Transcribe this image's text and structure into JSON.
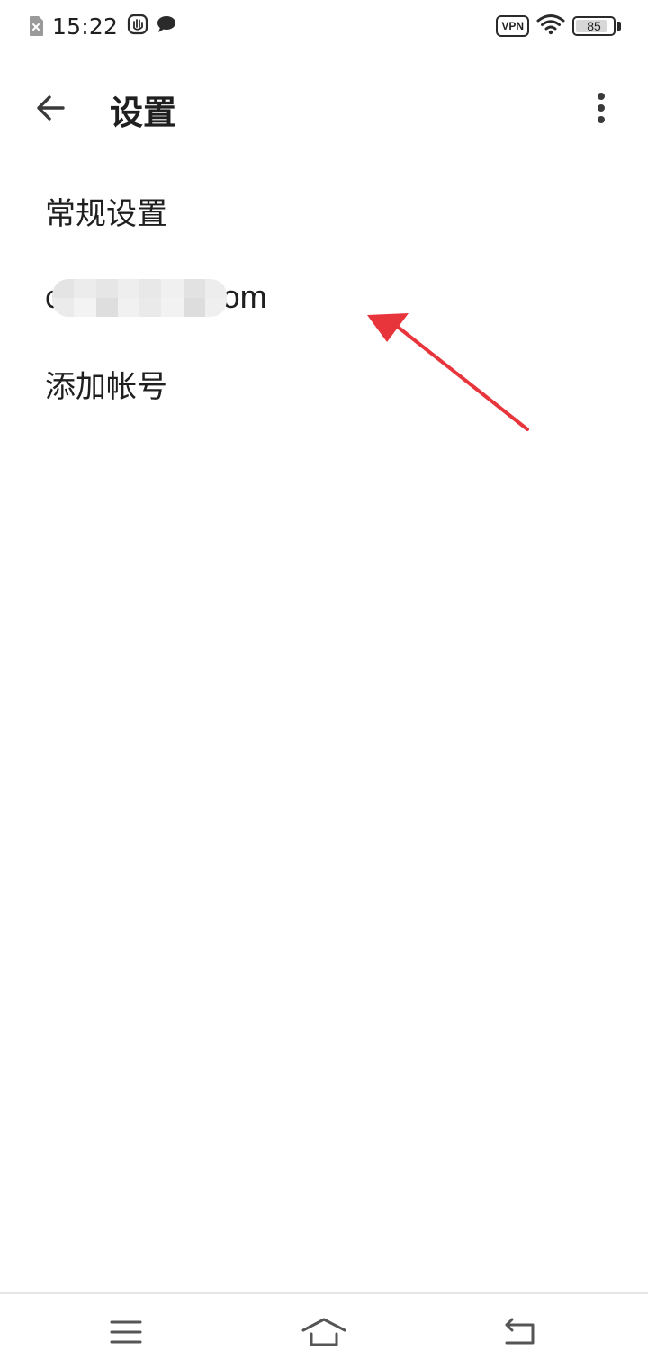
{
  "status_bar": {
    "time": "15:22",
    "vpn_label": "VPN",
    "battery_level": "85",
    "icons": [
      "sim-off-icon",
      "hand-icon",
      "chat-bubble-icon",
      "wifi-icon",
      "battery-icon"
    ]
  },
  "app_bar": {
    "title": "设置",
    "back_icon": "arrow-left-icon",
    "more_icon": "more-vertical-icon"
  },
  "settings": {
    "general_label": "常规设置",
    "account_email": "c          z@gmail.com",
    "add_account_label": "添加帐号"
  },
  "annotation": {
    "color": "#e8343b"
  },
  "nav_bar": {
    "icons": [
      "menu-icon",
      "home-icon",
      "back-return-icon"
    ]
  }
}
